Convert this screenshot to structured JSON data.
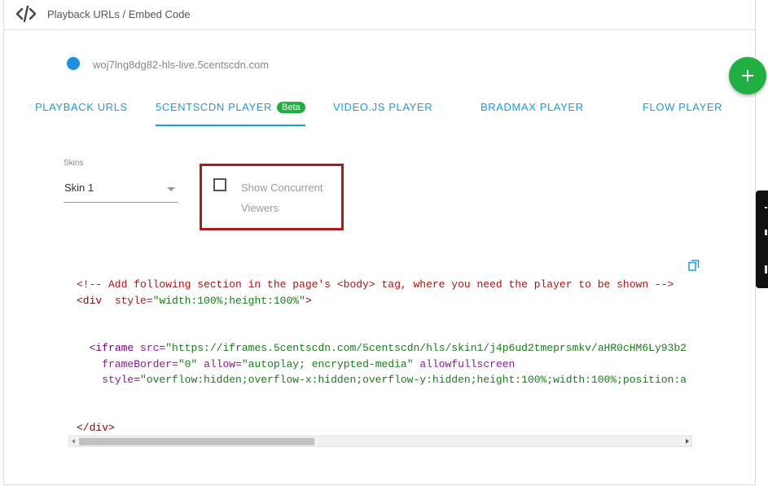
{
  "header": {
    "title": "Playback URLs / Embed Code",
    "icon": "code-icon"
  },
  "stream": {
    "name": "woj7lng8dg82-hls-live.5centscdn.com",
    "status_color": "#1a8fe3"
  },
  "tabs": [
    {
      "label": "PLAYBACK URLS",
      "active": false
    },
    {
      "label": "5CENTSCDN PLAYER",
      "active": true,
      "badge": "Beta"
    },
    {
      "label": "VIDEO.JS PLAYER",
      "active": false
    },
    {
      "label": "BRADMAX PLAYER",
      "active": false
    },
    {
      "label": "FLOW PLAYER",
      "active": false
    }
  ],
  "skins": {
    "label": "Skins",
    "value": "Skin 1"
  },
  "concurrent_viewers": {
    "label": "Show Concurrent Viewers",
    "checked": false
  },
  "code": {
    "comment": "<!-- Add following section in the page's <body> tag, where you need the player to be shown -->",
    "div_open_tag": "<div",
    "div_style_attr": "style=",
    "div_style_value": "\"width:100%;height:100%\"",
    "div_close_bracket": ">",
    "iframe_tag": "<iframe",
    "src_attr": "src=",
    "src_value": "\"https://iframes.5centscdn.com/5centscdn/hls/skin1/j4p6ud2tmeprsmkv/aHR0cHM6Ly93b2",
    "frameborder_attr": "frameBorder=",
    "frameborder_value": "\"0\"",
    "allow_attr": "allow=",
    "allow_value": "\"autoplay; encrypted-media\"",
    "allowfullscreen": "allowfullscreen",
    "style_attr": "style=",
    "style_value": "\"overflow:hidden;overflow-x:hidden;overflow-y:hidden;height:100%;width:100%;position:a",
    "div_close": "</div>"
  },
  "colors": {
    "accent": "#1e9ad6",
    "success": "#21ae43",
    "highlight_border": "#a81b1b"
  },
  "icons": [
    "code-icon",
    "copy-icon",
    "plus-icon",
    "caret-down-icon"
  ]
}
